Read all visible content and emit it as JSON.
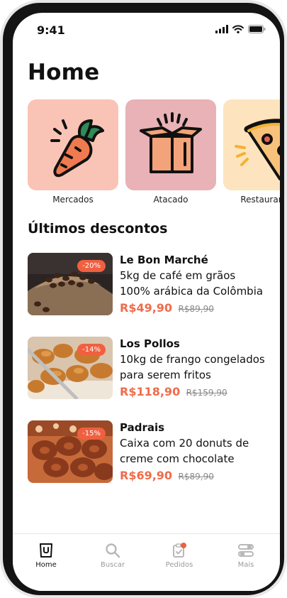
{
  "status_bar": {
    "time": "9:41"
  },
  "page_title": "Home",
  "categories": [
    {
      "label": "Mercados",
      "icon": "carrot-icon",
      "color": "#f9c4b6"
    },
    {
      "label": "Atacado",
      "icon": "box-icon",
      "color": "#e8b2b6"
    },
    {
      "label": "Restaurantes",
      "icon": "pizza-icon",
      "color": "#fde4be"
    }
  ],
  "section_title": "Últimos descontos",
  "offers": [
    {
      "store": "Le Bon Marché",
      "description": "5kg de café em grãos 100% arábica da Colômbia",
      "price": "R$49,90",
      "old_price": "R$89,90",
      "discount": "-20%"
    },
    {
      "store": "Los Pollos",
      "description": "10kg de frango congelados para serem fritos",
      "price": "R$118,90",
      "old_price": "R$159,90",
      "discount": "-14%"
    },
    {
      "store": "Padrais",
      "description": "Caixa com 20 donuts de creme com chocolate",
      "price": "R$69,90",
      "old_price": "R$89,90",
      "discount": "-15%"
    }
  ],
  "tabs": [
    {
      "label": "Home",
      "icon": "store-bag-icon",
      "active": true
    },
    {
      "label": "Buscar",
      "icon": "search-icon",
      "active": false
    },
    {
      "label": "Pedidos",
      "icon": "clipboard-icon",
      "active": false
    },
    {
      "label": "Mais",
      "icon": "toggles-icon",
      "active": false
    }
  ],
  "colors": {
    "accent": "#ef6c4b",
    "badge": "#f06040"
  }
}
